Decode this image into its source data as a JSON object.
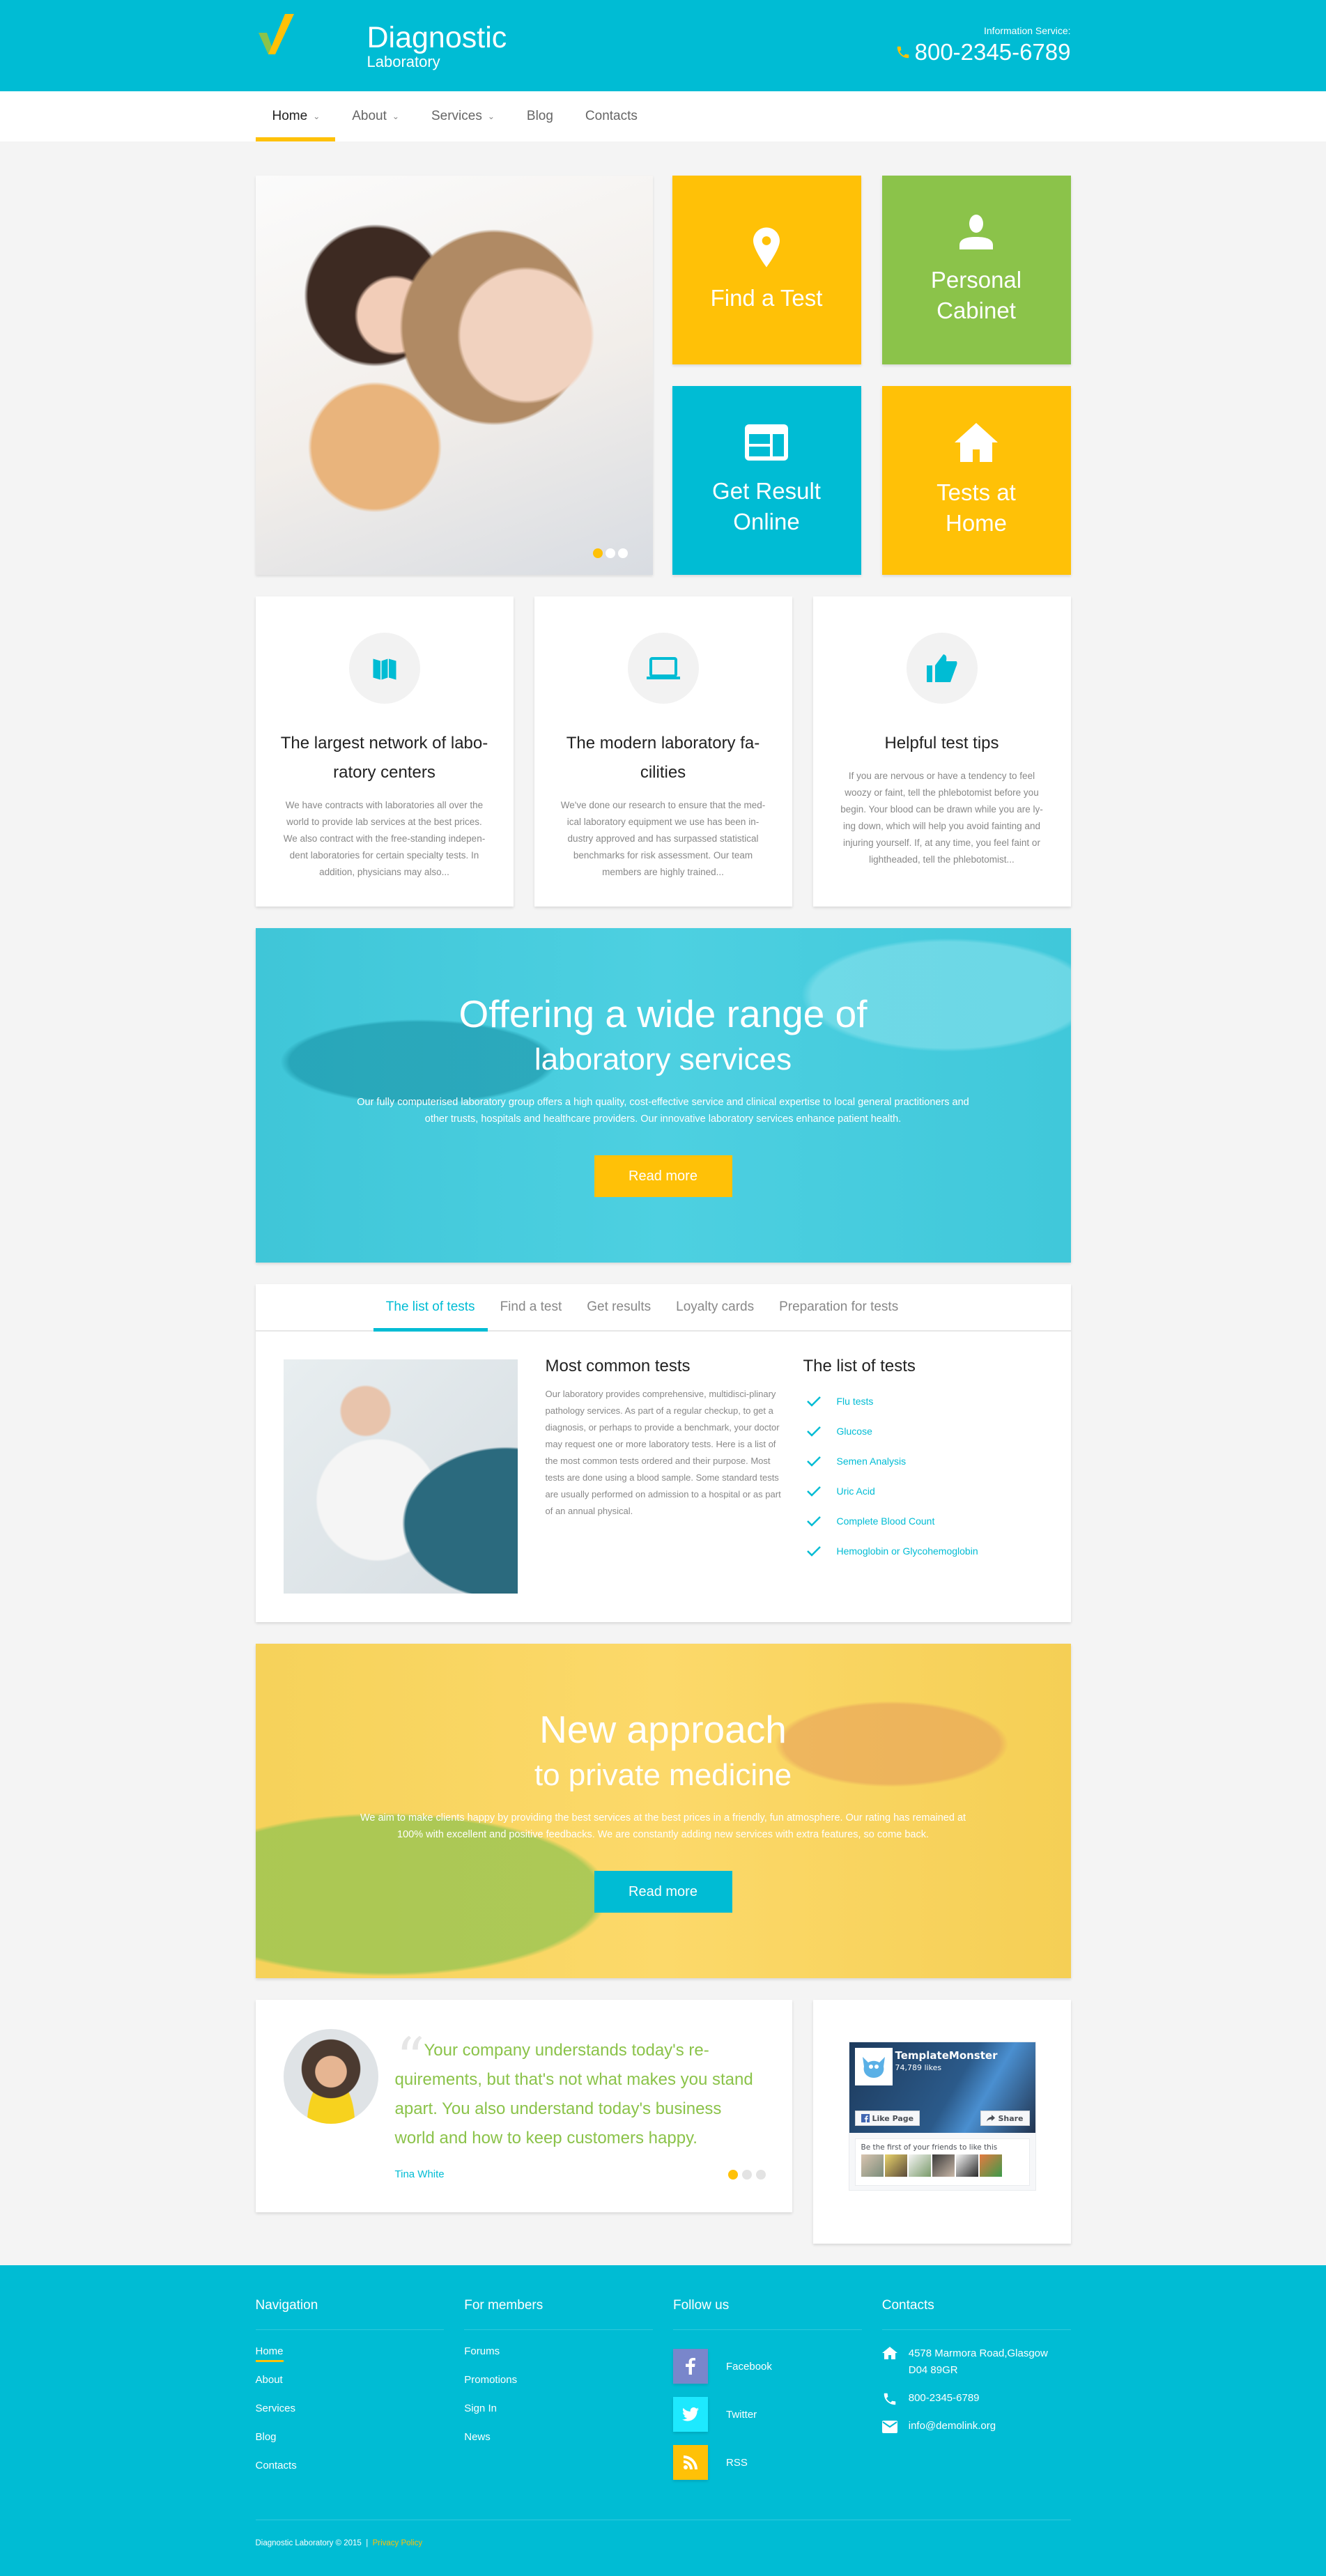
{
  "header": {
    "brand_title": "Diagnostic",
    "brand_subtitle": "Laboratory",
    "info_label": "Information Service:",
    "phone": "800-2345-6789",
    "logo_colors": {
      "left": "#8bc34a",
      "right": "#ffc107"
    }
  },
  "nav": {
    "items": [
      {
        "label": "Home",
        "dropdown": true,
        "active": true
      },
      {
        "label": "About",
        "dropdown": true
      },
      {
        "label": "Services",
        "dropdown": true
      },
      {
        "label": "Blog",
        "dropdown": false
      },
      {
        "label": "Contacts",
        "dropdown": false
      }
    ],
    "chevron": "⌄"
  },
  "hero": {
    "slider_dots": 3,
    "active_dot": 1,
    "tiles": [
      {
        "label": "Find a Test",
        "icon": "map-pin-icon",
        "color": "#ffc107"
      },
      {
        "label": "Personal Cabinet",
        "icon": "user-icon",
        "color": "#8bc34a"
      },
      {
        "label": "Get Result Online",
        "icon": "browser-window-icon",
        "color": "#00bcd4"
      },
      {
        "label": "Tests at Home",
        "icon": "home-icon",
        "color": "#ffc107"
      }
    ]
  },
  "features": [
    {
      "icon": "map-icon",
      "title": "The largest network of labo-ratory centers",
      "text": "We have contracts with laboratories all over the world to provide lab services at the best prices. We also contract with the free-standing indepen-dent laboratories for certain specialty tests. In addition, physicians may also..."
    },
    {
      "icon": "laptop-icon",
      "title": "The modern laboratory fa-cilities",
      "text": "We've done our research to ensure that the med-ical laboratory equipment we use has been in-dustry approved and has surpassed statistical benchmarks for risk assessment. Our team members are highly trained..."
    },
    {
      "icon": "thumbs-up-icon",
      "title": "Helpful test tips",
      "text": "If you are nervous or have a tendency to feel woozy or faint, tell the phlebotomist before you begin. Your blood can be drawn while you are ly-ing down, which will help you avoid fainting and injuring yourself. If, at any time, you feel faint or lightheaded, tell the phlebotomist..."
    }
  ],
  "banner1": {
    "title1": "Offering a wide range of",
    "title2": "laboratory services",
    "text": "Our fully computerised laboratory group offers a high quality, cost-effective service and clinical expertise to local general practitioners and other trusts, hospitals and healthcare providers. Our innovative laboratory services enhance patient health.",
    "button": "Read more"
  },
  "tabs": {
    "items": [
      "The list of tests",
      "Find a test",
      "Get results",
      "Loyalty cards",
      "Preparation for tests"
    ],
    "active": 0,
    "col1_title": "Most common tests",
    "col1_text": "Our laboratory provides comprehensive, multidisci-plinary pathology services. As part of a regular checkup, to get a diagnosis, or perhaps to provide a benchmark, your doctor may request one or more laboratory tests. Here is a list of the most common tests ordered and their purpose. Most tests are done using a blood sample. Some standard tests are usually performed on admission to a hospital or as part of an annual physical.",
    "col2_title": "The list of tests",
    "tests": [
      "Flu tests",
      "Glucose",
      "Semen Analysis",
      "Uric Acid",
      "Complete Blood Count",
      "Hemoglobin or Glycohemoglobin"
    ]
  },
  "banner2": {
    "title1": "New approach",
    "title2": "to private medicine",
    "text": "We aim to make clients happy by providing the best services at the best prices in a friendly, fun atmosphere. Our rating has remained at 100% with excellent and positive feedbacks. We are constantly adding new services with extra features, so come back.",
    "button": "Read more"
  },
  "testimonial": {
    "quote": "Your company understands today's re-quirements, but that's not what makes you stand apart. You also understand today's business world and how to keep customers happy.",
    "author": "Tina White",
    "dots": 3,
    "active_dot": 1
  },
  "facebook": {
    "page_name": "TemplateMonster",
    "likes": "74,789 likes",
    "like_button": "Like Page",
    "share_button": "Share",
    "friends_text": "Be the first of your friends to like this",
    "friend_faces": 6
  },
  "footer": {
    "navigation": {
      "title": "Navigation",
      "links": [
        "Home",
        "About",
        "Services",
        "Blog",
        "Contacts"
      ],
      "active": 0
    },
    "members": {
      "title": "For members",
      "links": [
        "Forums",
        "Promotions",
        "Sign In",
        "News"
      ]
    },
    "follow": {
      "title": "Follow us",
      "items": [
        {
          "label": "Facebook",
          "icon": "facebook-icon",
          "color": "#7986cb"
        },
        {
          "label": "Twitter",
          "icon": "twitter-icon",
          "color": "#1de9ff"
        },
        {
          "label": "RSS",
          "icon": "rss-icon",
          "color": "#ffc107"
        }
      ]
    },
    "contacts": {
      "title": "Contacts",
      "address": "4578 Marmora Road,Glasgow D04 89GR",
      "phone": "800-2345-6789",
      "email": "info@demolink.org"
    },
    "copyright": "Diagnostic Laboratory © 2015",
    "separator": "|",
    "privacy": "Privacy Policy"
  },
  "colors": {
    "primary": "#00bcd4",
    "accent": "#ffc107",
    "green": "#8bc34a",
    "background": "#f4f4f4"
  }
}
